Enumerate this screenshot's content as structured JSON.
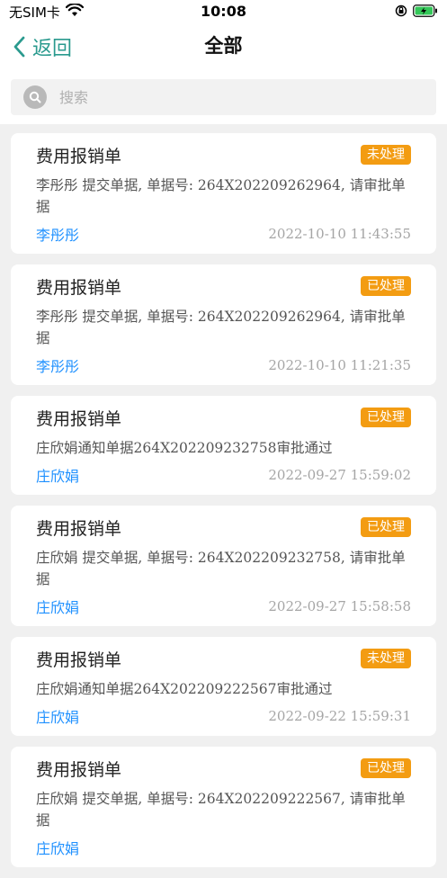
{
  "status": {
    "carrier": "无SIM卡",
    "time": "10:08"
  },
  "nav": {
    "back_label": "返回",
    "title": "全部"
  },
  "search": {
    "placeholder": "搜索"
  },
  "items": [
    {
      "title": "费用报销单",
      "status": "未处理",
      "desc": "李彤彤 提交单据, 单据号: 264X202209262964, 请审批单据",
      "name": "李彤彤",
      "time": "2022-10-10 11:43:55"
    },
    {
      "title": "费用报销单",
      "status": "已处理",
      "desc": "李彤彤 提交单据, 单据号: 264X202209262964, 请审批单据",
      "name": "李彤彤",
      "time": "2022-10-10 11:21:35"
    },
    {
      "title": "费用报销单",
      "status": "已处理",
      "desc": "庄欣娟通知单据264X202209232758审批通过",
      "name": "庄欣娟",
      "time": "2022-09-27 15:59:02"
    },
    {
      "title": "费用报销单",
      "status": "已处理",
      "desc": "庄欣娟 提交单据, 单据号: 264X202209232758, 请审批单据",
      "name": "庄欣娟",
      "time": "2022-09-27 15:58:58"
    },
    {
      "title": "费用报销单",
      "status": "未处理",
      "desc": "庄欣娟通知单据264X202209222567审批通过",
      "name": "庄欣娟",
      "time": "2022-09-22 15:59:31"
    },
    {
      "title": "费用报销单",
      "status": "已处理",
      "desc": "庄欣娟 提交单据, 单据号: 264X202209222567, 请审批单据",
      "name": "庄欣娟",
      "time": ""
    }
  ],
  "colors": {
    "accent": "#2a9a8e",
    "badge": "#f39c12",
    "link": "#1e90ff"
  }
}
